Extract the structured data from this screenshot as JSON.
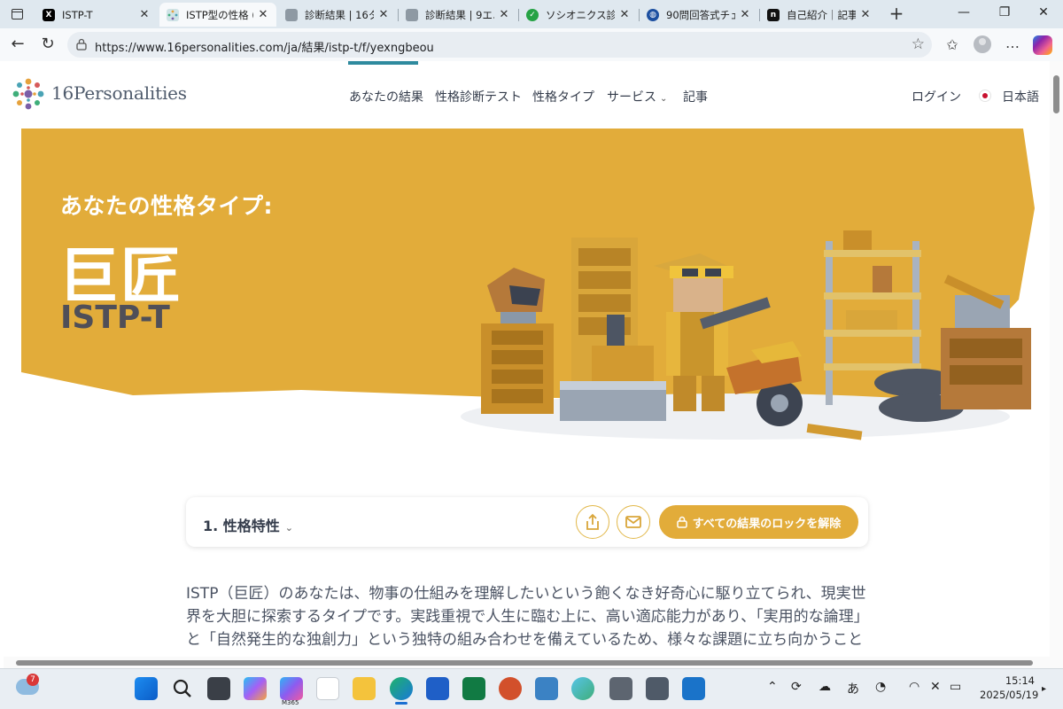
{
  "browser": {
    "tabs": [
      {
        "label": "ISTP-T",
        "favicon": "x-logo-icon",
        "active": false
      },
      {
        "label": "ISTP型の性格 (巨",
        "favicon": "16personalities-favicon-icon",
        "active": true
      },
      {
        "label": "診断結果 | 16タ",
        "favicon": "page-icon",
        "active": false
      },
      {
        "label": "診断結果 | 9エニ",
        "favicon": "page-icon",
        "active": false
      },
      {
        "label": "ソシオニクス診断",
        "favicon": "green-check-icon",
        "active": false
      },
      {
        "label": "90問回答式チェッ",
        "favicon": "globe-icon",
        "active": false
      },
      {
        "label": "自己紹介｜記事",
        "favicon": "note-logo-icon",
        "active": false
      }
    ],
    "url": "https://www.16personalities.com/ja/結果/istp-t/f/yexngbeou"
  },
  "site": {
    "logo_text": "16Personalities",
    "nav": [
      "あなたの結果",
      "性格診断テスト",
      "性格タイプ",
      "サービス",
      "記事"
    ],
    "login": "ログイン",
    "language": "日本語"
  },
  "hero": {
    "subtitle": "あなたの性格タイプ:",
    "title": "巨匠",
    "code": "ISTP-T",
    "bg_color": "#e2ac3a"
  },
  "section": {
    "title": "1. 性格特性",
    "unlock_label": "すべての結果のロックを解除"
  },
  "body_lines": [
    "ISTP（巨匠）のあなたは、物事の仕組みを理解したいという飽くなき好奇心に駆り立てられ、現実世",
    "界を大胆に探索するタイプです。実践重視で人生に臨む上に、高い適応能力があり、「実用的な論理」",
    "と「自然発生的な独創力」という独特の組み合わせを備えているため、様々な課題に立ち向かうこと"
  ],
  "taskbar": {
    "weather_badge": "7",
    "m365_label": "M365",
    "ime": "あ",
    "time": "15:14",
    "date": "2025/05/19"
  }
}
